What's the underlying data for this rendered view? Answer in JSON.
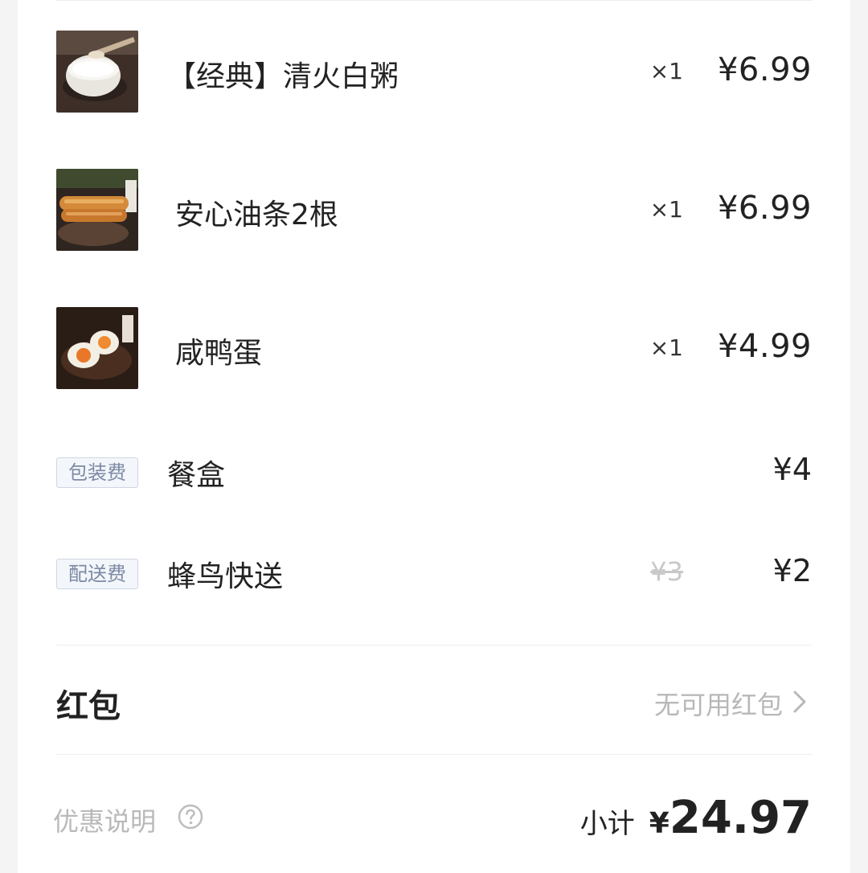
{
  "items": [
    {
      "name": "【经典】清火白粥",
      "qty": "×1",
      "price": "¥6.99",
      "image": "white-porridge"
    },
    {
      "name": "安心油条2根",
      "qty": "×1",
      "price": "¥6.99",
      "image": "fried-dough-sticks"
    },
    {
      "name": "咸鸭蛋",
      "qty": "×1",
      "price": "¥4.99",
      "image": "salted-duck-egg"
    }
  ],
  "fees": [
    {
      "tag": "包装费",
      "name": "餐盒",
      "original_price": "",
      "price": "¥4"
    },
    {
      "tag": "配送费",
      "name": "蜂鸟快送",
      "original_price": "¥3",
      "price": "¥2"
    }
  ],
  "red_packet": {
    "label": "红包",
    "value": "无可用红包",
    "icon": "chevron-right-icon"
  },
  "footer": {
    "promo_label": "优惠说明",
    "help_icon": "question-circle-icon",
    "subtotal_label": "小计",
    "currency": "¥",
    "subtotal_amount": "24.97"
  },
  "colors": {
    "background": "#ffffff",
    "tag_bg": "#f3f6fb",
    "tag_text": "#7d8aa3",
    "muted": "#b8b8b8"
  }
}
